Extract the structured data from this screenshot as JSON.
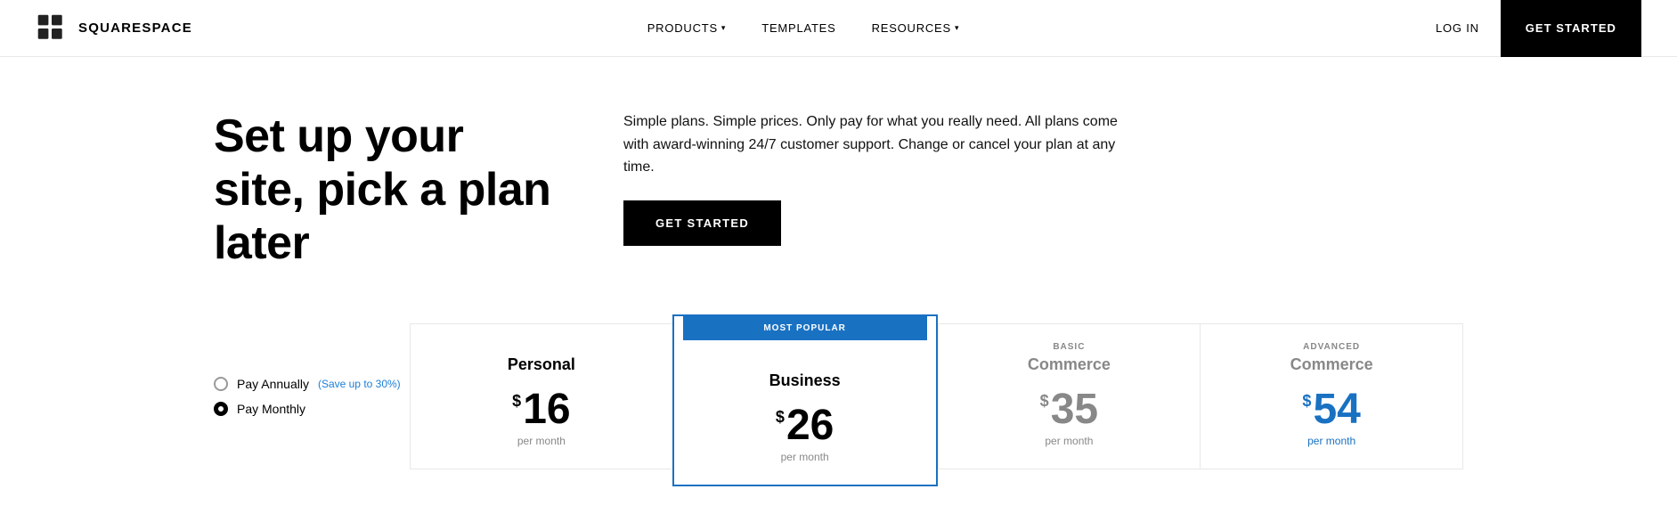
{
  "brand": {
    "name": "SQUARESPACE"
  },
  "navbar": {
    "items": [
      {
        "label": "PRODUCTS",
        "has_dropdown": true
      },
      {
        "label": "TEMPLATES",
        "has_dropdown": false
      },
      {
        "label": "RESOURCES",
        "has_dropdown": true
      }
    ],
    "login_label": "LOG IN",
    "cta_label": "GET STARTED"
  },
  "hero": {
    "title": "Set up your site, pick a plan later",
    "description": "Simple plans. Simple prices. Only pay for what you really need. All plans come with award-winning 24/7 customer support. Change or cancel your plan at any time.",
    "cta_label": "GET STARTED"
  },
  "billing": {
    "annually_label": "Pay Annually",
    "annually_save": "(Save up to 30%)",
    "monthly_label": "Pay Monthly"
  },
  "plans": [
    {
      "id": "personal",
      "label": "",
      "name": "Personal",
      "price": "16",
      "per_month": "per month",
      "featured": false,
      "color": "black"
    },
    {
      "id": "business",
      "label": "MOST POPULAR",
      "name": "Business",
      "price": "26",
      "per_month": "per month",
      "featured": true,
      "color": "black"
    },
    {
      "id": "basic-commerce",
      "label": "BASIC",
      "name": "Commerce",
      "price": "35",
      "per_month": "per month",
      "featured": false,
      "color": "grey"
    },
    {
      "id": "advanced-commerce",
      "label": "ADVANCED",
      "name": "Commerce",
      "price": "54",
      "per_month": "per month",
      "featured": false,
      "color": "blue"
    }
  ]
}
